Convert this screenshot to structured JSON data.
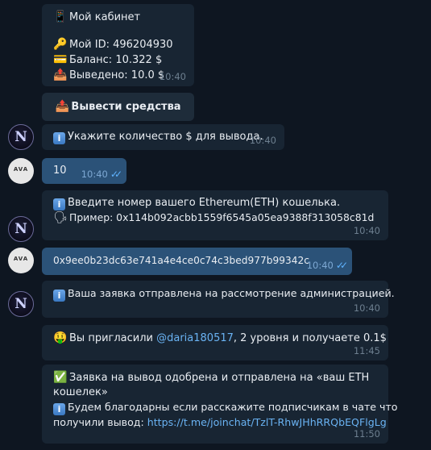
{
  "messages": {
    "cabinet": {
      "title_icon": "phone-icon",
      "title": "Мой кабинет",
      "id_line": "Мой ID: 496204930",
      "balance_line": "Баланс: 10.322 $",
      "withdrawn_line": "Выведено: 10.0 $",
      "time": "10:40"
    },
    "withdraw_button": "Вывести средства",
    "ask_amount": {
      "text": "Укажите количество $ для вывода.",
      "time": "10:40"
    },
    "user_amount": {
      "text": "10",
      "time": "10:40"
    },
    "ask_wallet": {
      "line1": "Введите номер вашего Ethereum(ETH) кошелька.",
      "line2": "Пример: 0x114b092acbb1559f6545a05ea9388f313058c81d",
      "time": "10:40"
    },
    "user_wallet": {
      "text": "0x9ee0b23dc63e741a4e4ce0c74c3bed977b99342c",
      "time": "10:40"
    },
    "request_sent": {
      "text": "Ваша заявка отправлена на рассмотрение администрацией.",
      "time": "10:40"
    },
    "invite": {
      "prefix": "Вы пригласили ",
      "mention": "@daria180517",
      "suffix": ", 2 уровня и получаете 0.1$",
      "time": "11:45"
    },
    "approved": {
      "line1": "Заявка на вывод одобрена и отправлена на «ваш ETH",
      "line2": "кошелек»",
      "line3": "Будем благодарны если расскажите подписчикам в чате что",
      "line4_prefix": "получили вывод: ",
      "link": "https://t.me/joinchat/TzlT-RhwJHhRRQbEQFlgLg",
      "time": "11:50"
    }
  },
  "colors": {
    "background": "#0e1621",
    "incoming_bubble": "#182533",
    "outgoing_bubble": "#2b5278",
    "link": "#6ab3f3",
    "read_checks": "#5fb3ff"
  }
}
